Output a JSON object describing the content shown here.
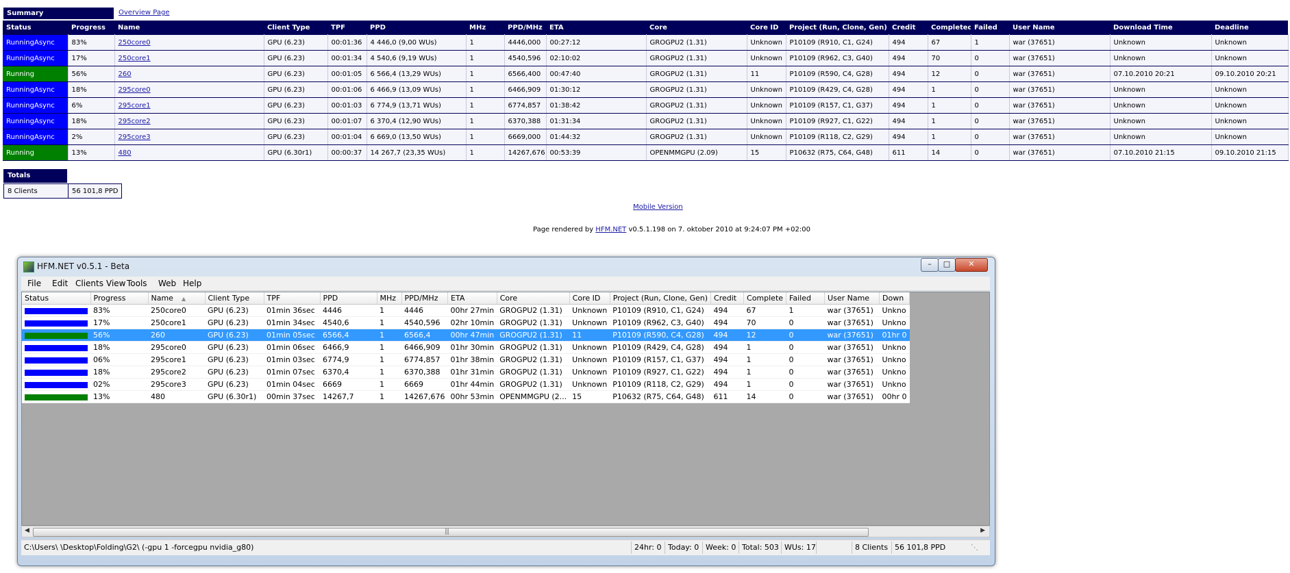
{
  "web": {
    "summary_label": "Summary",
    "overview_link": "Overview Page",
    "columns": [
      "Status",
      "Progress",
      "Name",
      "Client Type",
      "TPF",
      "PPD",
      "MHz",
      "PPD/MHz",
      "ETA",
      "Core",
      "Core ID",
      "Project (Run, Clone, Gen)",
      "Credit",
      "Completed",
      "Failed",
      "User Name",
      "Download Time",
      "Deadline"
    ],
    "rows": [
      {
        "status": "RunningAsync",
        "progress": "83%",
        "name": "250core0",
        "client_type": "GPU (6.23)",
        "tpf": "00:01:36",
        "ppd": "4 446,0 (9,00 WUs)",
        "mhz": "1",
        "ppd_mhz": "4446,000",
        "eta": "00:27:12",
        "core": "GROGPU2 (1.31)",
        "core_id": "Unknown",
        "project": "P10109 (R910, C1, G24)",
        "credit": "494",
        "completed": "67",
        "failed": "1",
        "user": "war (37651)",
        "download": "Unknown",
        "deadline": "Unknown"
      },
      {
        "status": "RunningAsync",
        "progress": "17%",
        "name": "250core1",
        "client_type": "GPU (6.23)",
        "tpf": "00:01:34",
        "ppd": "4 540,6 (9,19 WUs)",
        "mhz": "1",
        "ppd_mhz": "4540,596",
        "eta": "02:10:02",
        "core": "GROGPU2 (1.31)",
        "core_id": "Unknown",
        "project": "P10109 (R962, C3, G40)",
        "credit": "494",
        "completed": "70",
        "failed": "0",
        "user": "war (37651)",
        "download": "Unknown",
        "deadline": "Unknown"
      },
      {
        "status": "Running",
        "progress": "56%",
        "name": "260",
        "client_type": "GPU (6.23)",
        "tpf": "00:01:05",
        "ppd": "6 566,4 (13,29 WUs)",
        "mhz": "1",
        "ppd_mhz": "6566,400",
        "eta": "00:47:40",
        "core": "GROGPU2 (1.31)",
        "core_id": "11",
        "project": "P10109 (R590, C4, G28)",
        "credit": "494",
        "completed": "12",
        "failed": "0",
        "user": "war (37651)",
        "download": "07.10.2010 20:21",
        "deadline": "09.10.2010 20:21"
      },
      {
        "status": "RunningAsync",
        "progress": "18%",
        "name": "295core0",
        "client_type": "GPU (6.23)",
        "tpf": "00:01:06",
        "ppd": "6 466,9 (13,09 WUs)",
        "mhz": "1",
        "ppd_mhz": "6466,909",
        "eta": "01:30:12",
        "core": "GROGPU2 (1.31)",
        "core_id": "Unknown",
        "project": "P10109 (R429, C4, G28)",
        "credit": "494",
        "completed": "1",
        "failed": "0",
        "user": "war (37651)",
        "download": "Unknown",
        "deadline": "Unknown"
      },
      {
        "status": "RunningAsync",
        "progress": "6%",
        "name": "295core1",
        "client_type": "GPU (6.23)",
        "tpf": "00:01:03",
        "ppd": "6 774,9 (13,71 WUs)",
        "mhz": "1",
        "ppd_mhz": "6774,857",
        "eta": "01:38:42",
        "core": "GROGPU2 (1.31)",
        "core_id": "Unknown",
        "project": "P10109 (R157, C1, G37)",
        "credit": "494",
        "completed": "1",
        "failed": "0",
        "user": "war (37651)",
        "download": "Unknown",
        "deadline": "Unknown"
      },
      {
        "status": "RunningAsync",
        "progress": "18%",
        "name": "295core2",
        "client_type": "GPU (6.23)",
        "tpf": "00:01:07",
        "ppd": "6 370,4 (12,90 WUs)",
        "mhz": "1",
        "ppd_mhz": "6370,388",
        "eta": "01:31:34",
        "core": "GROGPU2 (1.31)",
        "core_id": "Unknown",
        "project": "P10109 (R927, C1, G22)",
        "credit": "494",
        "completed": "1",
        "failed": "0",
        "user": "war (37651)",
        "download": "Unknown",
        "deadline": "Unknown"
      },
      {
        "status": "RunningAsync",
        "progress": "2%",
        "name": "295core3",
        "client_type": "GPU (6.23)",
        "tpf": "00:01:04",
        "ppd": "6 669,0 (13,50 WUs)",
        "mhz": "1",
        "ppd_mhz": "6669,000",
        "eta": "01:44:32",
        "core": "GROGPU2 (1.31)",
        "core_id": "Unknown",
        "project": "P10109 (R118, C2, G29)",
        "credit": "494",
        "completed": "1",
        "failed": "0",
        "user": "war (37651)",
        "download": "Unknown",
        "deadline": "Unknown"
      },
      {
        "status": "Running",
        "progress": "13%",
        "name": "480",
        "client_type": "GPU (6.30r1)",
        "tpf": "00:00:37",
        "ppd": "14 267,7 (23,35 WUs)",
        "mhz": "1",
        "ppd_mhz": "14267,676",
        "eta": "00:53:39",
        "core": "OPENMMGPU (2.09)",
        "core_id": "15",
        "project": "P10632 (R75, C64, G48)",
        "credit": "611",
        "completed": "14",
        "failed": "0",
        "user": "war (37651)",
        "download": "07.10.2010 21:15",
        "deadline": "09.10.2010 21:15"
      }
    ],
    "totals_label": "Totals",
    "totals_clients": "8 Clients",
    "totals_ppd": "56 101,8 PPD",
    "mobile_link": "Mobile Version",
    "rendered_prefix": "Page rendered by ",
    "rendered_link": "HFM.NET",
    "rendered_suffix": " v0.5.1.198 on 7. oktober 2010 at 9:24:07 PM +02:00",
    "colors": {
      "header": "#00005a",
      "running_async": "#0000ff",
      "running": "#008000"
    }
  },
  "app": {
    "title": "HFM.NET v0.5.1 - Beta",
    "menu": [
      "File",
      "Edit",
      "Clients",
      "View",
      "Tools",
      "Web",
      "Help"
    ],
    "columns": [
      "Status",
      "Progress",
      "Name",
      "Client Type",
      "TPF",
      "PPD",
      "MHz",
      "PPD/MHz",
      "ETA",
      "Core",
      "Core ID",
      "Project (Run, Clone, Gen)",
      "Credit",
      "Complete",
      "Failed",
      "User Name",
      "Down"
    ],
    "rows": [
      {
        "status": "async",
        "progress": "83%",
        "name": "250core0",
        "client_type": "GPU (6.23)",
        "tpf": "01min 36sec",
        "ppd": "4446",
        "mhz": "1",
        "ppd_mhz": "4446",
        "eta": "00hr 27min",
        "core": "GROGPU2 (1.31)",
        "core_id": "Unknown",
        "project": "P10109 (R910, C1, G24)",
        "credit": "494",
        "complete": "67",
        "failed": "1",
        "user": "war (37651)",
        "down": "Unkno"
      },
      {
        "status": "async",
        "progress": "17%",
        "name": "250core1",
        "client_type": "GPU (6.23)",
        "tpf": "01min 34sec",
        "ppd": "4540,6",
        "mhz": "1",
        "ppd_mhz": "4540,596",
        "eta": "02hr 10min",
        "core": "GROGPU2 (1.31)",
        "core_id": "Unknown",
        "project": "P10109 (R962, C3, G40)",
        "credit": "494",
        "complete": "70",
        "failed": "0",
        "user": "war (37651)",
        "down": "Unkno"
      },
      {
        "status": "running",
        "progress": "56%",
        "name": "260",
        "client_type": "GPU (6.23)",
        "tpf": "01min 05sec",
        "ppd": "6566,4",
        "mhz": "1",
        "ppd_mhz": "6566,4",
        "eta": "00hr 47min",
        "core": "GROGPU2 (1.31)",
        "core_id": "11",
        "project": "P10109 (R590, C4, G28)",
        "credit": "494",
        "complete": "12",
        "failed": "0",
        "user": "war (37651)",
        "down": "01hr 0"
      },
      {
        "status": "async",
        "progress": "18%",
        "name": "295core0",
        "client_type": "GPU (6.23)",
        "tpf": "01min 06sec",
        "ppd": "6466,9",
        "mhz": "1",
        "ppd_mhz": "6466,909",
        "eta": "01hr 30min",
        "core": "GROGPU2 (1.31)",
        "core_id": "Unknown",
        "project": "P10109 (R429, C4, G28)",
        "credit": "494",
        "complete": "1",
        "failed": "0",
        "user": "war (37651)",
        "down": "Unkno"
      },
      {
        "status": "async",
        "progress": "06%",
        "name": "295core1",
        "client_type": "GPU (6.23)",
        "tpf": "01min 03sec",
        "ppd": "6774,9",
        "mhz": "1",
        "ppd_mhz": "6774,857",
        "eta": "01hr 38min",
        "core": "GROGPU2 (1.31)",
        "core_id": "Unknown",
        "project": "P10109 (R157, C1, G37)",
        "credit": "494",
        "complete": "1",
        "failed": "0",
        "user": "war (37651)",
        "down": "Unkno"
      },
      {
        "status": "async",
        "progress": "18%",
        "name": "295core2",
        "client_type": "GPU (6.23)",
        "tpf": "01min 07sec",
        "ppd": "6370,4",
        "mhz": "1",
        "ppd_mhz": "6370,388",
        "eta": "01hr 31min",
        "core": "GROGPU2 (1.31)",
        "core_id": "Unknown",
        "project": "P10109 (R927, C1, G22)",
        "credit": "494",
        "complete": "1",
        "failed": "0",
        "user": "war (37651)",
        "down": "Unkno"
      },
      {
        "status": "async",
        "progress": "02%",
        "name": "295core3",
        "client_type": "GPU (6.23)",
        "tpf": "01min 04sec",
        "ppd": "6669",
        "mhz": "1",
        "ppd_mhz": "6669",
        "eta": "01hr 44min",
        "core": "GROGPU2 (1.31)",
        "core_id": "Unknown",
        "project": "P10109 (R118, C2, G29)",
        "credit": "494",
        "complete": "1",
        "failed": "0",
        "user": "war (37651)",
        "down": "Unkno"
      },
      {
        "status": "running",
        "progress": "13%",
        "name": "480",
        "client_type": "GPU (6.30r1)",
        "tpf": "00min 37sec",
        "ppd": "14267,7",
        "mhz": "1",
        "ppd_mhz": "14267,676",
        "eta": "00hr 53min",
        "core": "OPENMMGPU (2...",
        "core_id": "15",
        "project": "P10632 (R75, C64, G48)",
        "credit": "611",
        "complete": "14",
        "failed": "0",
        "user": "war (37651)",
        "down": "00hr 0"
      }
    ],
    "selected_row": 2,
    "statusbar": {
      "path": "C:\\Users\\        \\Desktop\\Folding\\G2\\ (-gpu 1 -forcegpu nvidia_g80)",
      "day": "24hr: 0",
      "today": "Today: 0",
      "week": "Week: 0",
      "total": "Total: 503",
      "wus": "WUs: 17",
      "clients": "8 Clients",
      "ppd": "56 101,8 PPD"
    },
    "colors": {
      "async": "#0000ff",
      "running": "#008000",
      "selected": "#3399ff"
    }
  }
}
